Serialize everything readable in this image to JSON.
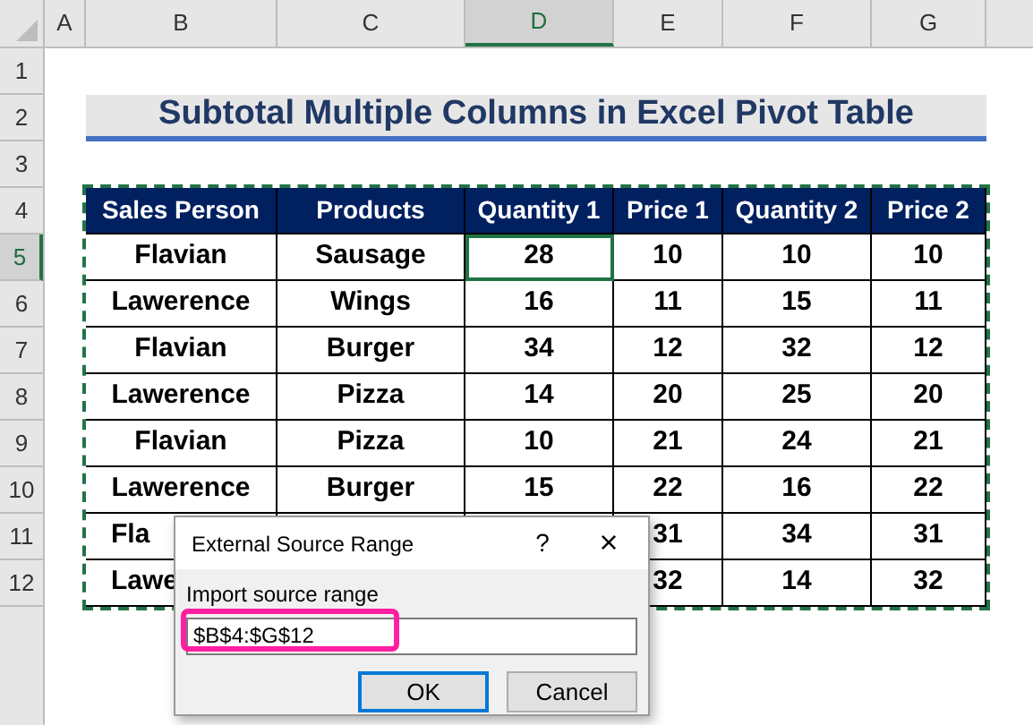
{
  "column_headers": [
    {
      "label": "A",
      "selected": false
    },
    {
      "label": "B",
      "selected": false
    },
    {
      "label": "C",
      "selected": false
    },
    {
      "label": "D",
      "selected": true
    },
    {
      "label": "E",
      "selected": false
    },
    {
      "label": "F",
      "selected": false
    },
    {
      "label": "G",
      "selected": false
    }
  ],
  "row_headers": [
    {
      "label": "1",
      "selected": false
    },
    {
      "label": "2",
      "selected": false
    },
    {
      "label": "3",
      "selected": false
    },
    {
      "label": "4",
      "selected": false
    },
    {
      "label": "5",
      "selected": true
    },
    {
      "label": "6",
      "selected": false
    },
    {
      "label": "7",
      "selected": false
    },
    {
      "label": "8",
      "selected": false
    },
    {
      "label": "9",
      "selected": false
    },
    {
      "label": "10",
      "selected": false
    },
    {
      "label": "11",
      "selected": false
    },
    {
      "label": "12",
      "selected": false
    }
  ],
  "title": "Subtotal Multiple Columns in Excel Pivot Table",
  "table": {
    "columns": [
      "Sales Person",
      "Products",
      "Quantity 1",
      "Price 1",
      "Quantity 2",
      "Price 2"
    ],
    "rows": [
      {
        "cells": [
          {
            "kind": "text",
            "text": "Flavian"
          },
          {
            "kind": "text",
            "text": "Sausage"
          },
          {
            "kind": "text",
            "text": "28",
            "selected": true
          },
          {
            "kind": "text",
            "text": "10"
          },
          {
            "kind": "text",
            "text": "10"
          },
          {
            "kind": "text",
            "text": "10"
          }
        ]
      },
      {
        "cells": [
          {
            "kind": "text",
            "text": "Lawerence"
          },
          {
            "kind": "text",
            "text": "Wings"
          },
          {
            "kind": "text",
            "text": "16"
          },
          {
            "kind": "text",
            "text": "11"
          },
          {
            "kind": "text",
            "text": "15"
          },
          {
            "kind": "text",
            "text": "11"
          }
        ]
      },
      {
        "cells": [
          {
            "kind": "text",
            "text": "Flavian"
          },
          {
            "kind": "text",
            "text": "Burger"
          },
          {
            "kind": "text",
            "text": "34"
          },
          {
            "kind": "text",
            "text": "12"
          },
          {
            "kind": "text",
            "text": "32"
          },
          {
            "kind": "text",
            "text": "12"
          }
        ]
      },
      {
        "cells": [
          {
            "kind": "text",
            "text": "Lawerence"
          },
          {
            "kind": "text",
            "text": "Pizza"
          },
          {
            "kind": "text",
            "text": "14"
          },
          {
            "kind": "text",
            "text": "20"
          },
          {
            "kind": "text",
            "text": "25"
          },
          {
            "kind": "text",
            "text": "20"
          }
        ]
      },
      {
        "cells": [
          {
            "kind": "text",
            "text": "Flavian"
          },
          {
            "kind": "text",
            "text": "Pizza"
          },
          {
            "kind": "text",
            "text": "10"
          },
          {
            "kind": "text",
            "text": "21"
          },
          {
            "kind": "text",
            "text": "24"
          },
          {
            "kind": "text",
            "text": "21"
          }
        ]
      },
      {
        "cells": [
          {
            "kind": "text",
            "text": "Lawerence"
          },
          {
            "kind": "text",
            "text": "Burger"
          },
          {
            "kind": "text",
            "text": "15"
          },
          {
            "kind": "text",
            "text": "22"
          },
          {
            "kind": "text",
            "text": "16"
          },
          {
            "kind": "text",
            "text": "22"
          }
        ]
      },
      {
        "cells": [
          {
            "kind": "cut",
            "text": "Fla"
          },
          {
            "kind": "covered"
          },
          {
            "kind": "covered"
          },
          {
            "kind": "text",
            "text": "31"
          },
          {
            "kind": "text",
            "text": "34"
          },
          {
            "kind": "text",
            "text": "31"
          }
        ]
      },
      {
        "cells": [
          {
            "kind": "cut",
            "text": "Lawe"
          },
          {
            "kind": "covered"
          },
          {
            "kind": "covered"
          },
          {
            "kind": "text",
            "text": "32"
          },
          {
            "kind": "text",
            "text": "14"
          },
          {
            "kind": "text",
            "text": "32"
          }
        ]
      }
    ]
  },
  "dialog": {
    "title": "External Source Range",
    "help": "?",
    "close": "×",
    "label": "Import source range",
    "value": "$B$4:$G$12",
    "buttons": [
      {
        "label": "OK",
        "default": true
      },
      {
        "label": "Cancel",
        "default": false
      }
    ]
  }
}
